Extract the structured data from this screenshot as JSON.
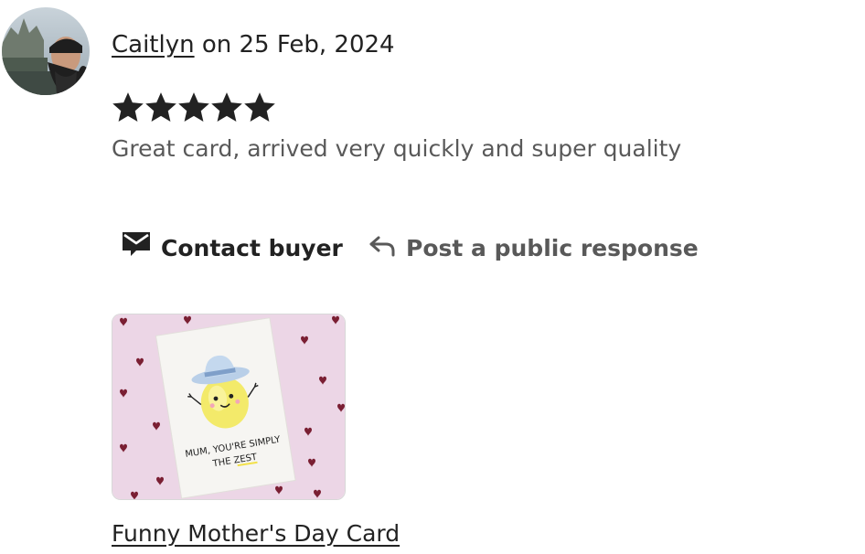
{
  "review": {
    "reviewer_name": "Caitlyn",
    "date_text": "on 25 Feb, 2024",
    "rating": 5,
    "max_rating": 5,
    "text": "Great card, arrived very quickly and super quality"
  },
  "actions": {
    "contact_label": "Contact buyer",
    "contact_icon": "envelope-icon",
    "public_response_label": "Post a public response",
    "public_response_icon": "reply-arrow-icon"
  },
  "listing": {
    "title": "Funny Mother's Day Card",
    "card_text_line1": "MUM, YOU'RE SIMPLY",
    "card_text_line2_a": "THE ",
    "card_text_line2_b": "ZEST",
    "background_color": "#ecd6e6",
    "heart_color": "#7a1f33"
  },
  "colors": {
    "primary_text": "#222222",
    "secondary_text": "#595959",
    "star": "#222222"
  }
}
